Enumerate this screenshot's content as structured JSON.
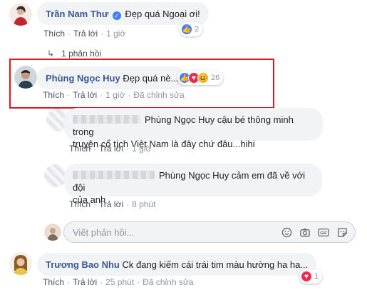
{
  "comments": [
    {
      "author": "Trần Nam Thư",
      "text": "Đẹp quá Ngoại ơi!",
      "like_label": "Thích",
      "reply_label": "Trả lời",
      "time": "1 giờ",
      "reaction_count": "2"
    },
    {
      "author": "Phùng Ngọc Huy",
      "text": "Đẹp quá nè...",
      "like_label": "Thích",
      "reply_label": "Trả lời",
      "time": "1 giờ",
      "edit_label": "Đã chỉnh sửa",
      "reaction_count": "26"
    },
    {
      "author": "Trương Bao Nhu",
      "text": "Ck đang kiếm cái trái tim màu hường ha ha...",
      "like_label": "Thích",
      "reply_label": "Trả lời",
      "time": "25 phút",
      "edit_label": "Đã chỉnh sửa",
      "reaction_count": "1"
    }
  ],
  "replies_toggle": "1 phản hồi",
  "replies": [
    {
      "text_line1": "Phùng Ngọc Huy cậu bé thông minh trong",
      "text_line2": "truyện cổ tích Việt Nam là đây chứ đâu...hihi",
      "like_label": "Thích",
      "reply_label": "Trả lời",
      "time": "1 giờ"
    },
    {
      "text_line1": "Phùng Ngọc Huy cảm em đã về với đội",
      "text_line2": "của anh",
      "like_label": "Thích",
      "reply_label": "Trả lời",
      "time": "8 phút"
    }
  ],
  "reply_input": {
    "placeholder": "Viết phản hồi..."
  },
  "colors": {
    "name_link": "#385898",
    "bubble_bg": "#f2f3f5",
    "highlight_border": "#e0141e",
    "like_blue": "#4080ff",
    "love_red": "#f0284a",
    "haha_yellow": "#f7b125"
  },
  "icons": [
    "verified-badge-icon",
    "like-reaction-icon",
    "love-reaction-icon",
    "haha-reaction-icon",
    "reply-arrow-icon",
    "emoji-icon",
    "camera-icon",
    "gif-icon",
    "sticker-icon"
  ]
}
